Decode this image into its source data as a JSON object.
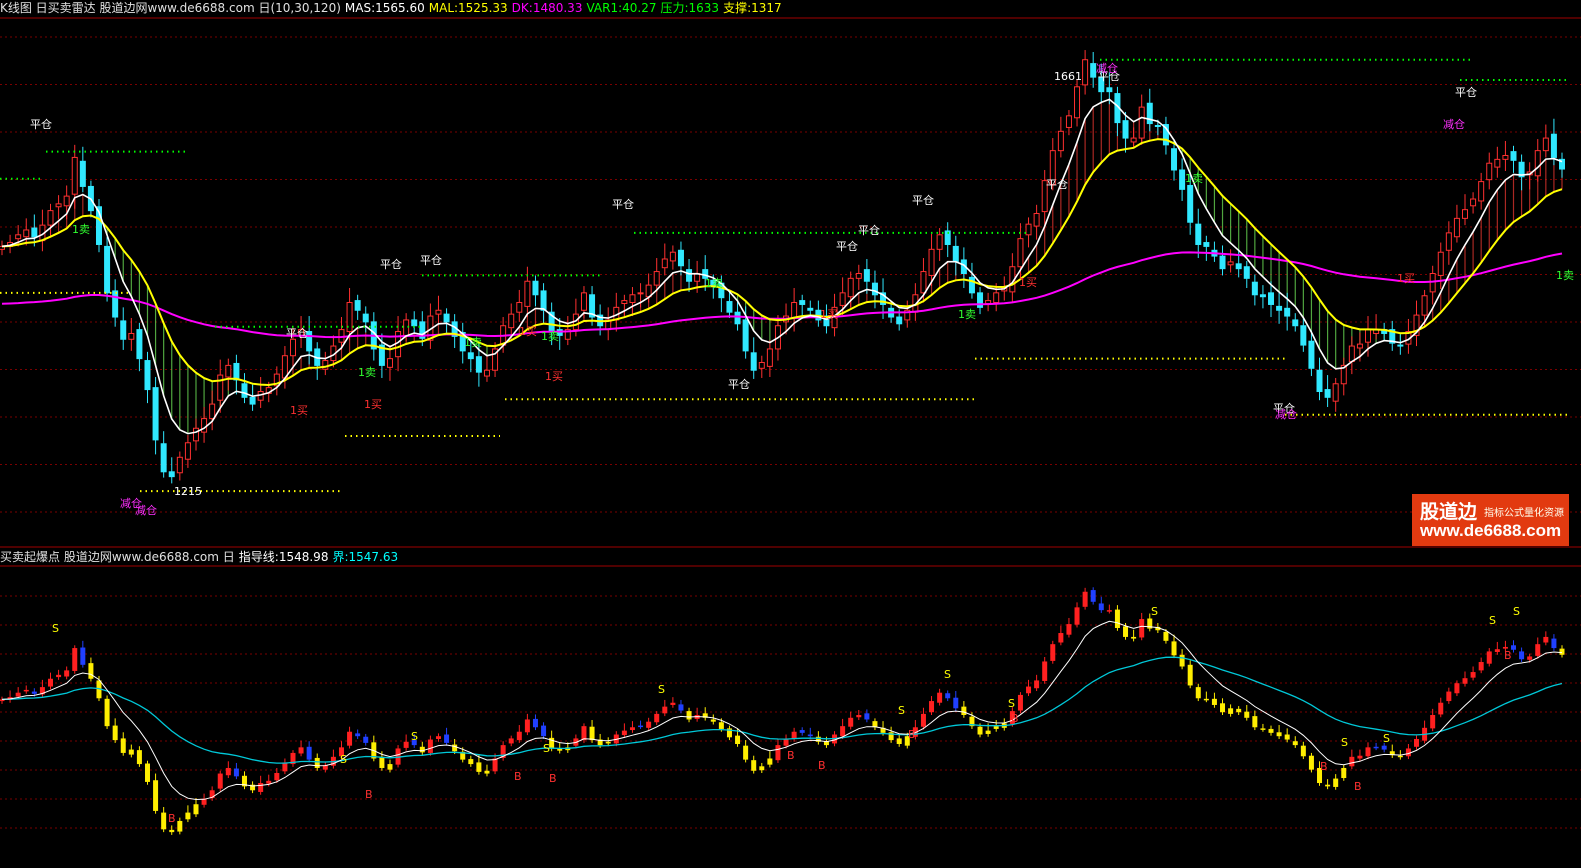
{
  "top_panel": {
    "title": "K线图 日买卖雷达 股道边网www.de6688.com 日(10,30,120)",
    "indicators": [
      {
        "label": "MAS:1565.60",
        "color": "#ffffff"
      },
      {
        "label": "MAL:1525.33",
        "color": "#ffff00"
      },
      {
        "label": "DK:1480.33",
        "color": "#ff00ff"
      },
      {
        "label": "VAR1:40.27",
        "color": "#00ff00"
      },
      {
        "label": "压力:1633",
        "color": "#00ff00"
      },
      {
        "label": "支撑:1317",
        "color": "#ffff00"
      }
    ],
    "annotations": [
      "平仓",
      "减仓",
      "1买",
      "1卖"
    ],
    "price_labels": [
      "1661",
      "1215"
    ]
  },
  "bottom_panel": {
    "title": "买卖起爆点 股道边网www.de6688.com 日",
    "indicators": [
      {
        "label": "指导线:1548.98",
        "color": "#ffffff"
      },
      {
        "label": "界:1547.63",
        "color": "#00ffff"
      }
    ],
    "signals": [
      "S",
      "B"
    ]
  },
  "watermark": {
    "line1": "股道边",
    "line2": "指标公式量化资源",
    "url": "www.de6688.com"
  },
  "chart_data": [
    {
      "type": "candlestick",
      "title": "日买卖雷达",
      "ylim": [
        1180,
        1700
      ],
      "price_levels": {
        "high": 1661,
        "low": 1215
      },
      "series": [
        {
          "name": "MAS",
          "color": "#ffffff",
          "last": 1565.6
        },
        {
          "name": "MAL",
          "color": "#ffff00",
          "last": 1525.33
        },
        {
          "name": "DK",
          "color": "#ff00ff",
          "last": 1480.33
        }
      ],
      "closes": [
        1468,
        1472,
        1480,
        1485,
        1478,
        1490,
        1505,
        1512,
        1520,
        1560,
        1530,
        1505,
        1470,
        1420,
        1395,
        1372,
        1378,
        1352,
        1320,
        1268,
        1235,
        1230,
        1250,
        1265,
        1280,
        1290,
        1305,
        1335,
        1345,
        1330,
        1312,
        1305,
        1318,
        1322,
        1336,
        1355,
        1372,
        1382,
        1360,
        1345,
        1350,
        1365,
        1382,
        1410,
        1402,
        1390,
        1362,
        1345,
        1352,
        1380,
        1392,
        1386,
        1373,
        1396,
        1402,
        1390,
        1375,
        1360,
        1352,
        1338,
        1340,
        1362,
        1386,
        1398,
        1410,
        1432,
        1418,
        1402,
        1380,
        1376,
        1382,
        1398,
        1420,
        1395,
        1386,
        1392,
        1405,
        1412,
        1418,
        1420,
        1428,
        1442,
        1455,
        1462,
        1448,
        1432,
        1440,
        1435,
        1428,
        1415,
        1400,
        1388,
        1360,
        1340,
        1348,
        1362,
        1386,
        1396,
        1410,
        1408,
        1402,
        1392,
        1386,
        1405,
        1420,
        1435,
        1440,
        1432,
        1418,
        1408,
        1395,
        1388,
        1402,
        1418,
        1442,
        1465,
        1480,
        1470,
        1452,
        1440,
        1420,
        1405,
        1412,
        1420,
        1425,
        1447,
        1476,
        1491,
        1502,
        1536,
        1567,
        1587,
        1603,
        1633,
        1661,
        1643,
        1628,
        1628,
        1596,
        1580,
        1580,
        1612,
        1595,
        1592,
        1573,
        1547,
        1527,
        1493,
        1470,
        1468,
        1458,
        1445,
        1452,
        1445,
        1435,
        1418,
        1416,
        1408,
        1402,
        1396,
        1386,
        1366,
        1342,
        1318,
        1312,
        1326,
        1345,
        1365,
        1367,
        1382,
        1382,
        1378,
        1368,
        1365,
        1380,
        1397,
        1417,
        1440,
        1462,
        1482,
        1497,
        1506,
        1517,
        1535,
        1554,
        1558,
        1562,
        1557,
        1540,
        1545,
        1567,
        1580,
        1560,
        1548
      ]
    },
    {
      "type": "line",
      "title": "买卖起爆点",
      "series": [
        {
          "name": "指导线",
          "color": "#ffffff",
          "last": 1548.98
        },
        {
          "name": "界",
          "color": "#00ffff",
          "last": 1547.63
        }
      ]
    }
  ]
}
